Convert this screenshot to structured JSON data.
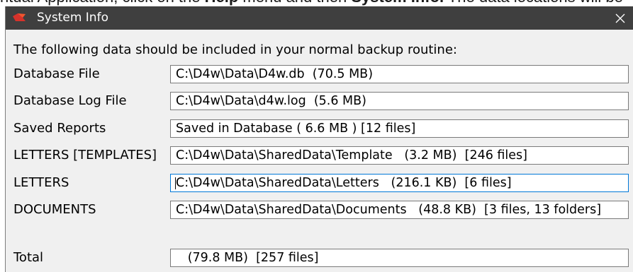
{
  "page_text": {
    "lead": "ntual Application, click on the ",
    "help": "Help",
    "mid": " menu and then ",
    "system_info": "System Info.",
    "tail": " The data locations will be"
  },
  "window": {
    "title": "System Info"
  },
  "icons": {
    "app": "d4w-logo-icon",
    "close": "close-icon"
  },
  "intro": "The following data should be included in your normal backup routine:",
  "rows": [
    {
      "label": "Database File",
      "value": "C:\\D4w\\Data\\D4w.db  (70.5 MB)"
    },
    {
      "label": "Database Log File",
      "value": "C:\\D4w\\Data\\d4w.log  (5.6 MB)"
    },
    {
      "label": "Saved Reports",
      "value": "Saved in Database ( 6.6 MB ) [12 files]"
    },
    {
      "label": "LETTERS [TEMPLATES]",
      "value": "C:\\D4w\\Data\\SharedData\\Template   (3.2 MB)  [246 files]"
    },
    {
      "label": "LETTERS",
      "value": "C:\\D4w\\Data\\SharedData\\Letters   (216.1 KB)  [6 files]",
      "focused": true
    },
    {
      "label": "DOCUMENTS",
      "value": "C:\\D4w\\Data\\SharedData\\Documents   (48.8 KB)  [3 files, 13 folders]"
    }
  ],
  "total": {
    "label": "Total",
    "value": "   (79.8 MB)  [257 files]"
  },
  "colors": {
    "titlebar": "#3f3f3f",
    "dialog_background": "#f0f0f0",
    "field_border": "#7a7a7a",
    "focus_border": "#0078d7",
    "title_text": "#ffffff",
    "logo_red": "#d6322b",
    "logo_orange": "#f0562f"
  }
}
